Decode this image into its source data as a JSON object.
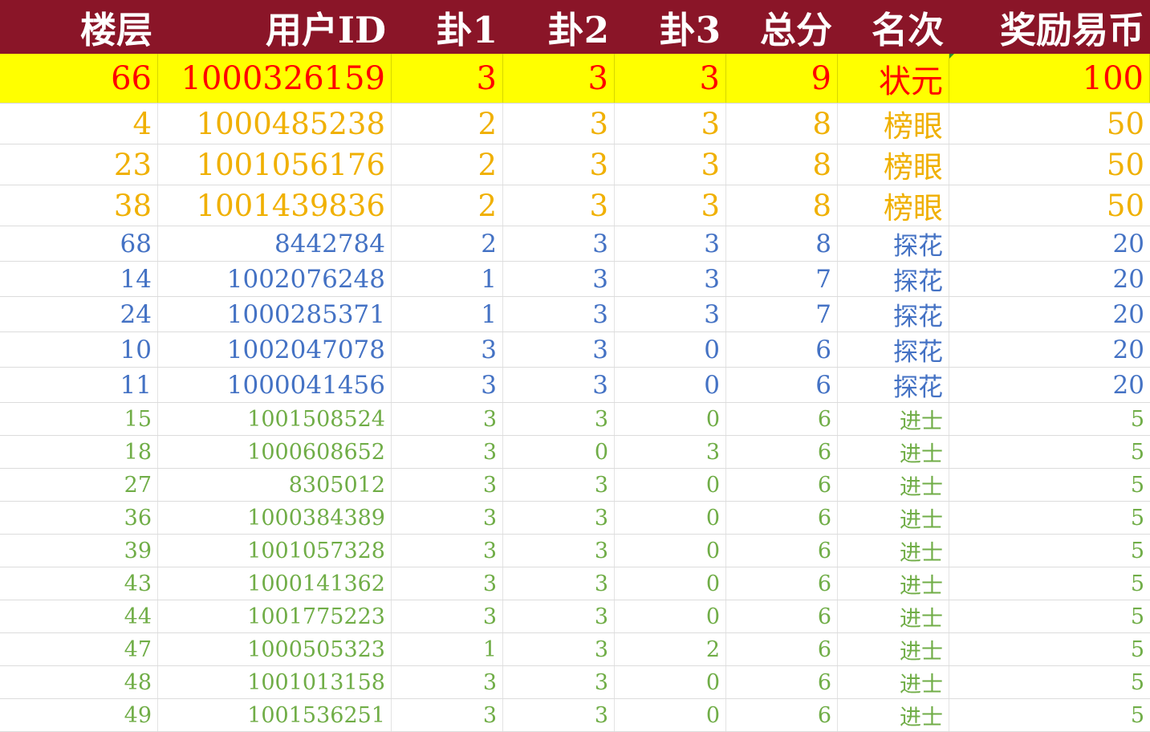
{
  "colors": {
    "header_bg": "#8a1528",
    "header_text": "#ffffff",
    "top_row_bg": "#ffff00",
    "zhuangyuan": "#ff0000",
    "bangyan": "#f0b000",
    "tanhua": "#4472c4",
    "jinshi": "#70ad47"
  },
  "headers": [
    "楼层",
    "用户ID",
    "卦1",
    "卦2",
    "卦3",
    "总分",
    "名次",
    "奖励易币"
  ],
  "rows": [
    {
      "tier": "zhuangyuan",
      "cells": [
        "66",
        "1000326159",
        "3",
        "3",
        "3",
        "9",
        "状元",
        "100"
      ]
    },
    {
      "tier": "bangyan",
      "cells": [
        "4",
        "1000485238",
        "2",
        "3",
        "3",
        "8",
        "榜眼",
        "50"
      ]
    },
    {
      "tier": "bangyan",
      "cells": [
        "23",
        "1001056176",
        "2",
        "3",
        "3",
        "8",
        "榜眼",
        "50"
      ]
    },
    {
      "tier": "bangyan",
      "cells": [
        "38",
        "1001439836",
        "2",
        "3",
        "3",
        "8",
        "榜眼",
        "50"
      ]
    },
    {
      "tier": "tanhua",
      "cells": [
        "68",
        "8442784",
        "2",
        "3",
        "3",
        "8",
        "探花",
        "20"
      ]
    },
    {
      "tier": "tanhua",
      "cells": [
        "14",
        "1002076248",
        "1",
        "3",
        "3",
        "7",
        "探花",
        "20"
      ]
    },
    {
      "tier": "tanhua",
      "cells": [
        "24",
        "1000285371",
        "1",
        "3",
        "3",
        "7",
        "探花",
        "20"
      ]
    },
    {
      "tier": "tanhua",
      "cells": [
        "10",
        "1002047078",
        "3",
        "3",
        "0",
        "6",
        "探花",
        "20"
      ]
    },
    {
      "tier": "tanhua",
      "cells": [
        "11",
        "1000041456",
        "3",
        "3",
        "0",
        "6",
        "探花",
        "20"
      ]
    },
    {
      "tier": "jinshi",
      "cells": [
        "15",
        "1001508524",
        "3",
        "3",
        "0",
        "6",
        "进士",
        "5"
      ]
    },
    {
      "tier": "jinshi",
      "cells": [
        "18",
        "1000608652",
        "3",
        "0",
        "3",
        "6",
        "进士",
        "5"
      ]
    },
    {
      "tier": "jinshi",
      "cells": [
        "27",
        "8305012",
        "3",
        "3",
        "0",
        "6",
        "进士",
        "5"
      ]
    },
    {
      "tier": "jinshi",
      "cells": [
        "36",
        "1000384389",
        "3",
        "3",
        "0",
        "6",
        "进士",
        "5"
      ]
    },
    {
      "tier": "jinshi",
      "cells": [
        "39",
        "1001057328",
        "3",
        "3",
        "0",
        "6",
        "进士",
        "5"
      ]
    },
    {
      "tier": "jinshi",
      "cells": [
        "43",
        "1000141362",
        "3",
        "3",
        "0",
        "6",
        "进士",
        "5"
      ]
    },
    {
      "tier": "jinshi",
      "cells": [
        "44",
        "1001775223",
        "3",
        "3",
        "0",
        "6",
        "进士",
        "5"
      ]
    },
    {
      "tier": "jinshi",
      "cells": [
        "47",
        "1000505323",
        "1",
        "3",
        "2",
        "6",
        "进士",
        "5"
      ]
    },
    {
      "tier": "jinshi",
      "cells": [
        "48",
        "1001013158",
        "3",
        "3",
        "0",
        "6",
        "进士",
        "5"
      ]
    },
    {
      "tier": "jinshi",
      "cells": [
        "49",
        "1001536251",
        "3",
        "3",
        "0",
        "6",
        "进士",
        "5"
      ]
    }
  ]
}
